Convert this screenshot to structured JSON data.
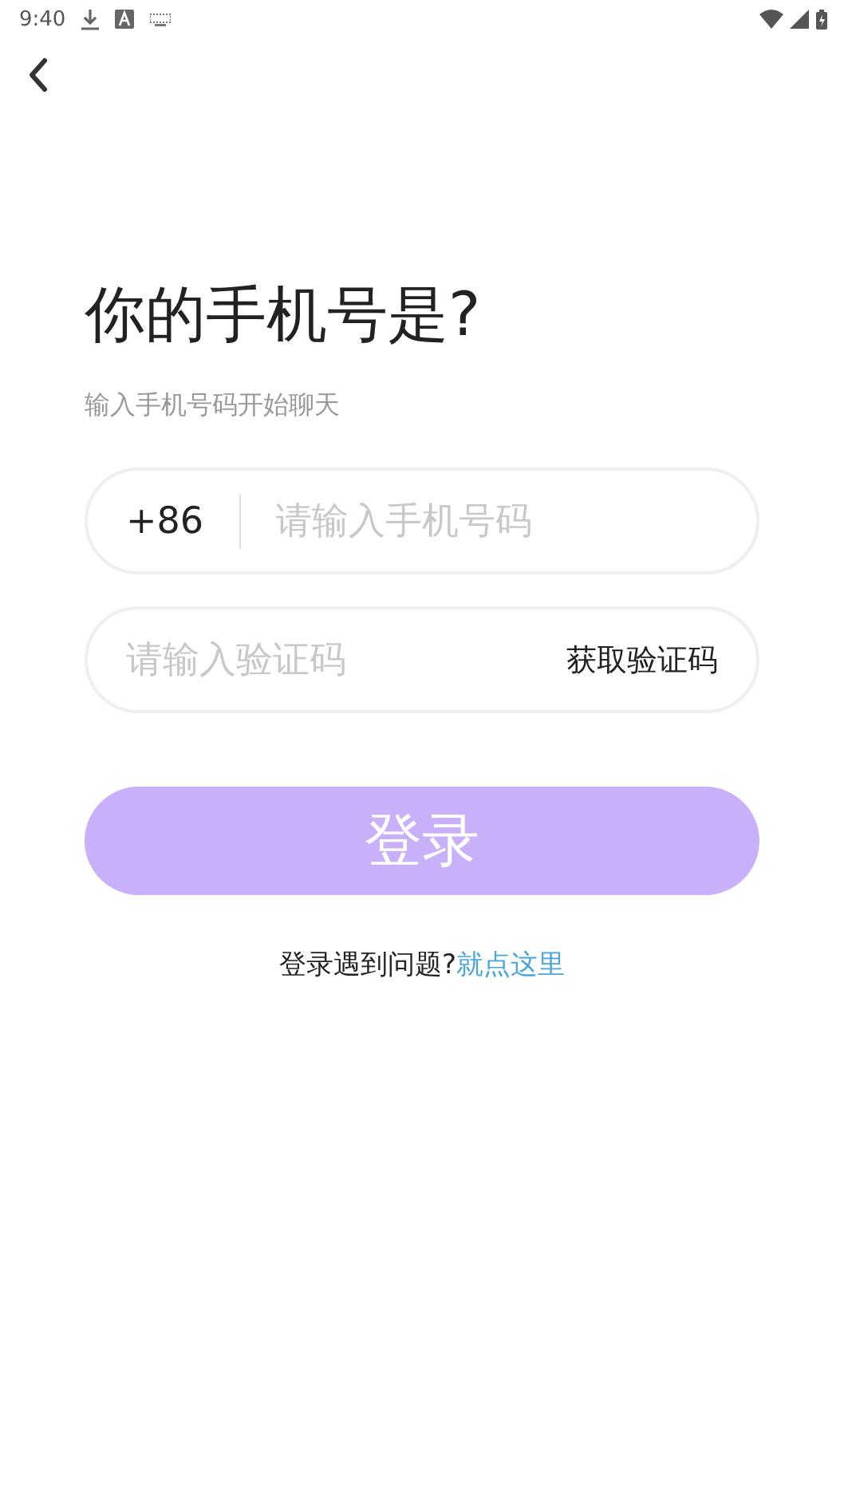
{
  "status_bar": {
    "time": "9:40"
  },
  "title": "你的手机号是?",
  "subtitle": "输入手机号码开始聊天",
  "phone_field": {
    "country_code": "+86",
    "placeholder": "请输入手机号码"
  },
  "code_field": {
    "placeholder": "请输入验证码",
    "action": "获取验证码"
  },
  "login_button": {
    "label": "登录",
    "disabled": true
  },
  "help": {
    "text": "登录遇到问题?",
    "link": "就点这里"
  }
}
